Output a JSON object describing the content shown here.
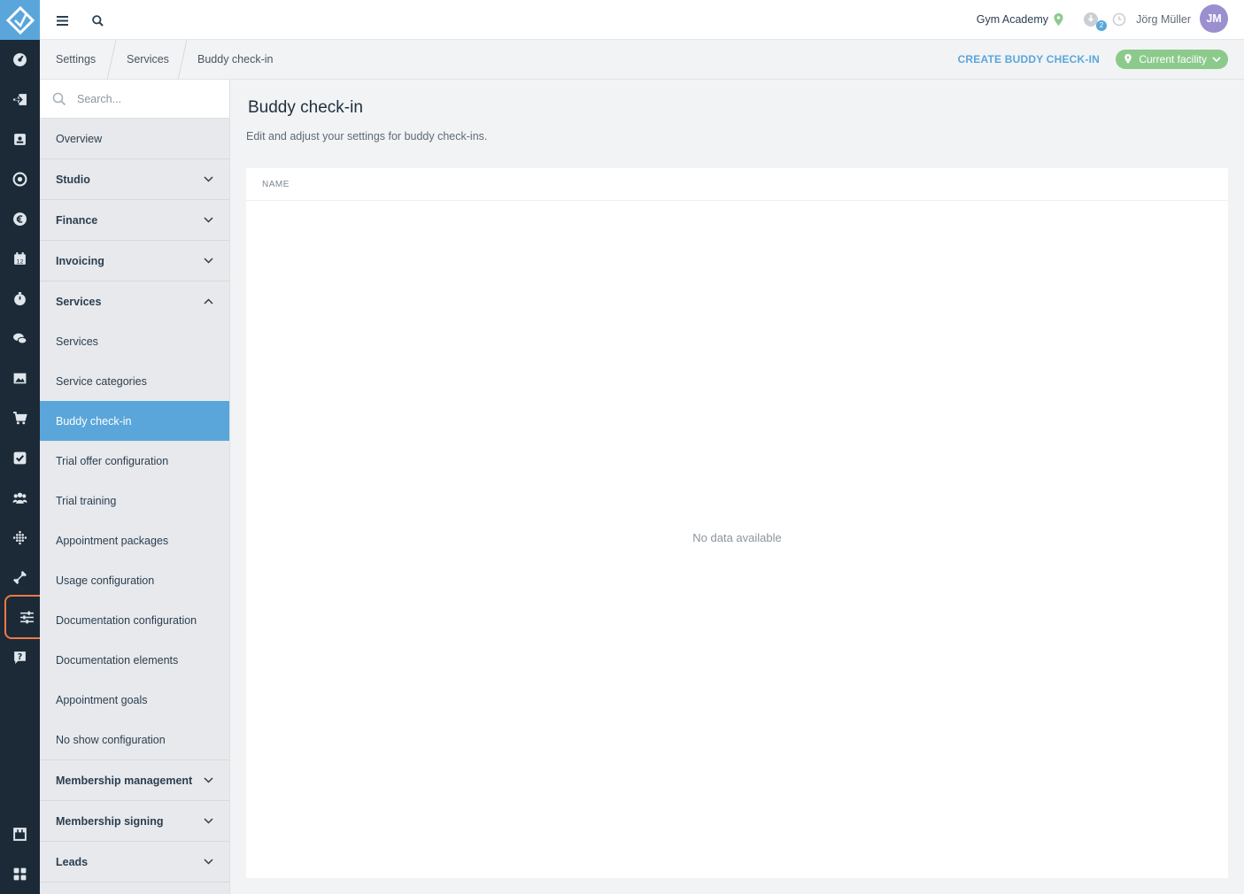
{
  "topbar": {
    "studio_name": "Gym Academy",
    "notification_count": "2",
    "user_name": "Jörg Müller",
    "user_initials": "JM"
  },
  "breadcrumb": [
    "Settings",
    "Services",
    "Buddy check-in"
  ],
  "actions": {
    "create_label": "CREATE BUDDY CHECK-IN",
    "facility_label": "Current facility"
  },
  "sidebar": {
    "search_placeholder": "Search...",
    "items": [
      {
        "label": "Overview"
      },
      {
        "label": "Studio"
      },
      {
        "label": "Finance"
      },
      {
        "label": "Invoicing"
      },
      {
        "label": "Services"
      },
      {
        "label": "Services"
      },
      {
        "label": "Service categories"
      },
      {
        "label": "Buddy check-in"
      },
      {
        "label": "Trial offer configuration"
      },
      {
        "label": "Trial training"
      },
      {
        "label": "Appointment packages"
      },
      {
        "label": "Usage configuration"
      },
      {
        "label": "Documentation configuration"
      },
      {
        "label": "Documentation elements"
      },
      {
        "label": "Appointment goals"
      },
      {
        "label": "No show configuration"
      },
      {
        "label": "Membership management"
      },
      {
        "label": "Membership signing"
      },
      {
        "label": "Leads"
      }
    ]
  },
  "main": {
    "title": "Buddy check-in",
    "subtitle": "Edit and adjust your settings for buddy check-ins.",
    "table": {
      "columns": [
        "NAME"
      ],
      "empty_text": "No data available"
    }
  },
  "colors": {
    "rail": "#1b2a36",
    "accent": "#5aa6da",
    "facility": "#8cca8c",
    "highlight": "#ee7a46",
    "avatar": "#9b8fd0"
  },
  "icons": {
    "rail": [
      "dashboard-icon",
      "check-in-icon",
      "contacts-icon",
      "target-icon",
      "euro-icon",
      "calendar-icon",
      "stopwatch-icon",
      "chat-icon",
      "image-icon",
      "cart-icon",
      "tasks-icon",
      "members-icon",
      "dots-grid-icon",
      "dumbbell-icon",
      "settings-sliders-icon",
      "help-icon",
      "shop-icon",
      "apps-icon"
    ]
  }
}
